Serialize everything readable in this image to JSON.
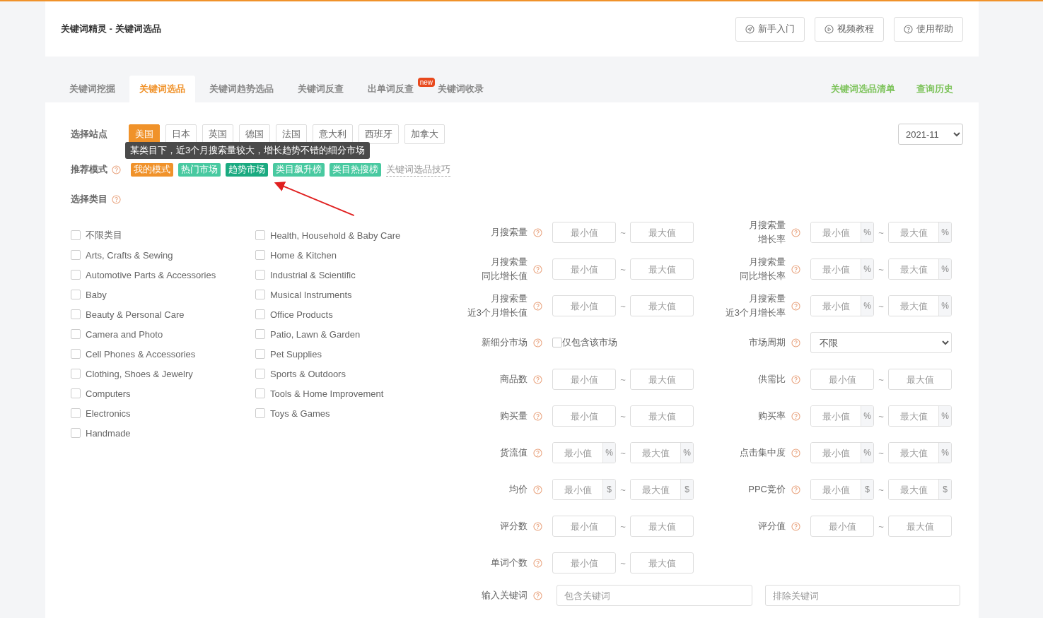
{
  "header": {
    "title": "关键词精灵 - 关键词选品",
    "buttons": [
      {
        "label": "新手入门",
        "kind": "send"
      },
      {
        "label": "视频教程",
        "kind": "play"
      },
      {
        "label": "使用帮助",
        "kind": "help"
      }
    ]
  },
  "tabs": [
    {
      "label": "关键词挖掘",
      "selected": false
    },
    {
      "label": "关键词选品",
      "selected": true
    },
    {
      "label": "关键词趋势选品",
      "selected": false
    },
    {
      "label": "关键词反查",
      "selected": false
    },
    {
      "label": "出单词反查",
      "selected": false,
      "badge": "new"
    },
    {
      "label": "关键词收录",
      "selected": false
    }
  ],
  "tab_links": [
    "关键词选品清单",
    "查询历史"
  ],
  "sites": {
    "label": "选择站点",
    "options": [
      {
        "label": "美国",
        "selected": true
      },
      {
        "label": "日本",
        "selected": false
      },
      {
        "label": "英国",
        "selected": false
      },
      {
        "label": "德国",
        "selected": false
      },
      {
        "label": "法国",
        "selected": false
      },
      {
        "label": "意大利",
        "selected": false
      },
      {
        "label": "西班牙",
        "selected": false
      },
      {
        "label": "加拿大",
        "selected": false
      }
    ],
    "month": "2021-11"
  },
  "modes": {
    "label": "推荐模式",
    "tooltip": "某类目下，近3个月搜索量较大，增长趋势不错的细分市场",
    "items": [
      {
        "label": "我的模式",
        "color": "#f0922a"
      },
      {
        "label": "热门市场",
        "color": "#48c9a0"
      },
      {
        "label": "趋势市场",
        "color": "#1aaa80"
      },
      {
        "label": "类目飙升榜",
        "color": "#48c9a0"
      },
      {
        "label": "类目热搜榜",
        "color": "#48c9a0"
      }
    ],
    "tip_link": "关键词选品技巧"
  },
  "categories": {
    "label": "选择类目",
    "items": [
      {
        "label": "不限类目",
        "checked": false
      },
      {
        "label": "Arts, Crafts & Sewing",
        "checked": false
      },
      {
        "label": "Automotive Parts & Accessories",
        "checked": false
      },
      {
        "label": "Baby",
        "checked": false
      },
      {
        "label": "Beauty & Personal Care",
        "checked": false
      },
      {
        "label": "Camera and Photo",
        "checked": false
      },
      {
        "label": "Cell Phones & Accessories",
        "checked": false
      },
      {
        "label": "Clothing, Shoes & Jewelry",
        "checked": false
      },
      {
        "label": "Computers",
        "checked": false
      },
      {
        "label": "Electronics",
        "checked": false
      },
      {
        "label": "Handmade",
        "checked": false
      },
      {
        "label": "Health, Household & Baby Care",
        "checked": false
      },
      {
        "label": "Home & Kitchen",
        "checked": false
      },
      {
        "label": "Industrial & Scientific",
        "checked": false
      },
      {
        "label": "Musical Instruments",
        "checked": false
      },
      {
        "label": "Office Products",
        "checked": false
      },
      {
        "label": "Patio, Lawn & Garden",
        "checked": false
      },
      {
        "label": "Pet Supplies",
        "checked": false
      },
      {
        "label": "Sports & Outdoors",
        "checked": false
      },
      {
        "label": "Tools & Home Improvement",
        "checked": false
      },
      {
        "label": "Toys & Games",
        "checked": false
      }
    ]
  },
  "filters": [
    {
      "label": [
        "月搜索量"
      ],
      "kind": "range",
      "min": {
        "placeholder": "最小值"
      },
      "separator": "~",
      "max": {
        "placeholder": "最大值"
      }
    },
    {
      "label": [
        "月搜索量",
        "增长率"
      ],
      "kind": "range",
      "unit": "%",
      "min": {
        "placeholder": "最小值"
      },
      "separator": "~",
      "max": {
        "placeholder": "最大值"
      }
    },
    {
      "label": [
        "月搜索量",
        "同比增长值"
      ],
      "kind": "range",
      "min": {
        "placeholder": "最小值"
      },
      "separator": "~",
      "max": {
        "placeholder": "最大值"
      }
    },
    {
      "label": [
        "月搜索量",
        "同比增长率"
      ],
      "kind": "range",
      "unit": "%",
      "min": {
        "placeholder": "最小值"
      },
      "separator": "~",
      "max": {
        "placeholder": "最大值"
      }
    },
    {
      "label": [
        "月搜索量",
        "近3个月增长值"
      ],
      "kind": "range",
      "min": {
        "placeholder": "最小值"
      },
      "separator": "~",
      "max": {
        "placeholder": "最大值"
      }
    },
    {
      "label": [
        "月搜索量",
        "近3个月增长率"
      ],
      "kind": "range",
      "unit": "%",
      "min": {
        "placeholder": "最小值"
      },
      "separator": "~",
      "max": {
        "placeholder": "最大值"
      }
    },
    {
      "label": [
        "新细分市场"
      ],
      "kind": "check",
      "option": "仅包含该市场",
      "checked": false
    },
    {
      "label": [
        "市场周期"
      ],
      "kind": "select",
      "value": "不限"
    },
    {
      "label": [
        "商品数"
      ],
      "kind": "range",
      "min": {
        "placeholder": "最小值"
      },
      "separator": "~",
      "max": {
        "placeholder": "最大值"
      }
    },
    {
      "label": [
        "供需比"
      ],
      "kind": "range",
      "min": {
        "placeholder": "最小值"
      },
      "separator": "~",
      "max": {
        "placeholder": "最大值"
      }
    },
    {
      "label": [
        "购买量"
      ],
      "kind": "range",
      "min": {
        "placeholder": "最小值"
      },
      "separator": "~",
      "max": {
        "placeholder": "最大值"
      }
    },
    {
      "label": [
        "购买率"
      ],
      "kind": "range",
      "unit": "%",
      "min": {
        "placeholder": "最小值"
      },
      "separator": "~",
      "max": {
        "placeholder": "最大值"
      }
    },
    {
      "label": [
        "货流值"
      ],
      "kind": "range",
      "unit": "%",
      "min": {
        "placeholder": "最小值"
      },
      "separator": "~",
      "max": {
        "placeholder": "最大值"
      }
    },
    {
      "label": [
        "点击集中度"
      ],
      "kind": "range",
      "unit": "%",
      "min": {
        "placeholder": "最小值"
      },
      "separator": "~",
      "max": {
        "placeholder": "最大值"
      }
    },
    {
      "label": [
        "均价"
      ],
      "kind": "range",
      "unit": "$",
      "min": {
        "placeholder": "最小值"
      },
      "separator": "~",
      "max": {
        "placeholder": "最大值"
      }
    },
    {
      "label": [
        "PPC竞价"
      ],
      "kind": "range",
      "unit": "$",
      "min": {
        "placeholder": "最小值"
      },
      "separator": "~",
      "max": {
        "placeholder": "最大值"
      }
    },
    {
      "label": [
        "评分数"
      ],
      "kind": "range",
      "min": {
        "placeholder": "最小值"
      },
      "separator": "~",
      "max": {
        "placeholder": "最大值"
      }
    },
    {
      "label": [
        "评分值"
      ],
      "kind": "range",
      "min": {
        "placeholder": "最小值"
      },
      "separator": "~",
      "max": {
        "placeholder": "最大值"
      }
    },
    {
      "label": [
        "单词个数"
      ],
      "kind": "range",
      "min": {
        "placeholder": "最小值"
      },
      "separator": "~",
      "max": {
        "placeholder": "最大值"
      }
    }
  ],
  "keywords": {
    "label": "输入关键词",
    "include": {
      "placeholder": "包含关键词"
    },
    "exclude": {
      "placeholder": "排除关键词"
    }
  }
}
